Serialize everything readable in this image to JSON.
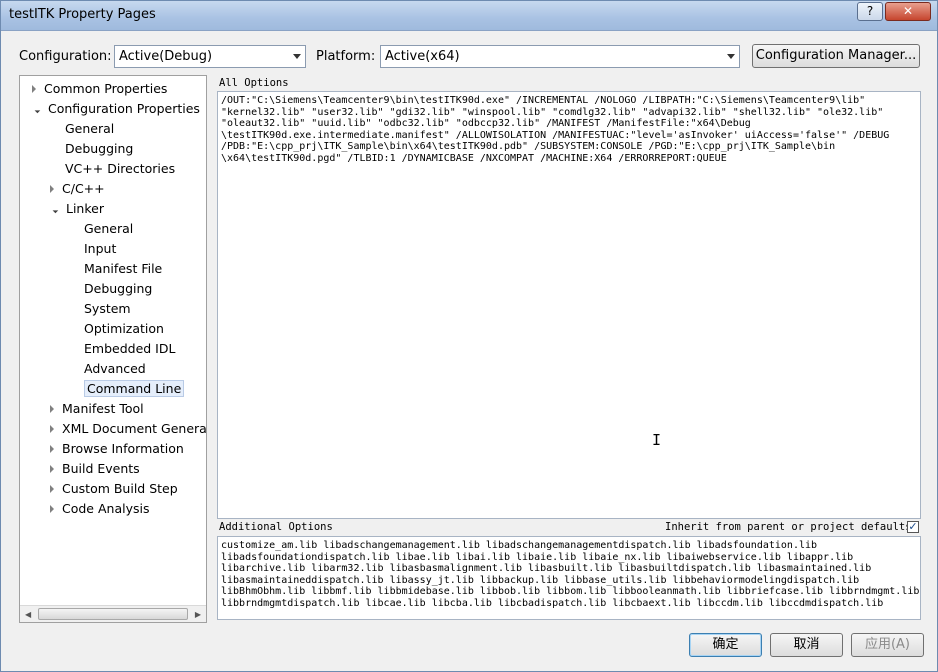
{
  "window": {
    "title": "testITK Property Pages",
    "help_glyph": "?",
    "close_glyph": "✕"
  },
  "config": {
    "configuration_label": "Configuration:",
    "configuration_value": "Active(Debug)",
    "platform_label": "Platform:",
    "platform_value": "Active(x64)",
    "manager_button": "Configuration Manager..."
  },
  "tree": {
    "items": [
      {
        "label": "Common Properties",
        "expander": "collapsed"
      },
      {
        "label": "Configuration Properties",
        "expander": "expanded"
      },
      {
        "label": "General",
        "expander": "none"
      },
      {
        "label": "Debugging",
        "expander": "none"
      },
      {
        "label": "VC++ Directories",
        "expander": "none"
      },
      {
        "label": "C/C++",
        "expander": "collapsed"
      },
      {
        "label": "Linker",
        "expander": "expanded"
      },
      {
        "label": "General",
        "expander": "none"
      },
      {
        "label": "Input",
        "expander": "none"
      },
      {
        "label": "Manifest File",
        "expander": "none"
      },
      {
        "label": "Debugging",
        "expander": "none"
      },
      {
        "label": "System",
        "expander": "none"
      },
      {
        "label": "Optimization",
        "expander": "none"
      },
      {
        "label": "Embedded IDL",
        "expander": "none"
      },
      {
        "label": "Advanced",
        "expander": "none"
      },
      {
        "label": "Command Line",
        "expander": "none",
        "selected": true
      },
      {
        "label": "Manifest Tool",
        "expander": "collapsed"
      },
      {
        "label": "XML Document Generat",
        "expander": "collapsed"
      },
      {
        "label": "Browse Information",
        "expander": "collapsed"
      },
      {
        "label": "Build Events",
        "expander": "collapsed"
      },
      {
        "label": "Custom Build Step",
        "expander": "collapsed"
      },
      {
        "label": "Code Analysis",
        "expander": "collapsed"
      }
    ]
  },
  "all_options": {
    "label": "All Options",
    "text": "/OUT:\"C:\\Siemens\\Teamcenter9\\bin\\testITK90d.exe\" /INCREMENTAL /NOLOGO /LIBPATH:\"C:\\Siemens\\Teamcenter9\\lib\"\n\"kernel32.lib\" \"user32.lib\" \"gdi32.lib\" \"winspool.lib\" \"comdlg32.lib\" \"advapi32.lib\" \"shell32.lib\" \"ole32.lib\"\n\"oleaut32.lib\" \"uuid.lib\" \"odbc32.lib\" \"odbccp32.lib\" /MANIFEST /ManifestFile:\"x64\\Debug\n\\testITK90d.exe.intermediate.manifest\" /ALLOWISOLATION /MANIFESTUAC:\"level='asInvoker' uiAccess='false'\" /DEBUG\n/PDB:\"E:\\cpp_prj\\ITK_Sample\\bin\\x64\\testITK90d.pdb\" /SUBSYSTEM:CONSOLE /PGD:\"E:\\cpp_prj\\ITK_Sample\\bin\n\\x64\\testITK90d.pgd\" /TLBID:1 /DYNAMICBASE /NXCOMPAT /MACHINE:X64 /ERRORREPORT:QUEUE"
  },
  "additional_options": {
    "label": "Additional Options",
    "inherit_label": "Inherit from parent or project defaults",
    "inherit_checked": "✓",
    "text": "customize_am.lib libadschangemanagement.lib libadschangemanagementdispatch.lib libadsfoundation.lib\nlibadsfoundationdispatch.lib libae.lib libai.lib libaie.lib libaie_nx.lib libaiwebservice.lib libappr.lib\nlibarchive.lib libarm32.lib libasbasmalignment.lib libasbuilt.lib libasbuiltdispatch.lib libasmaintained.lib\nlibasmaintaineddispatch.lib libassy_jt.lib libbackup.lib libbase_utils.lib libbehaviormodelingdispatch.lib\nlibBhmObhm.lib libbmf.lib libbmidebase.lib libbob.lib libbom.lib libbooleanmath.lib libbriefcase.lib libbrndmgmt.lib\nlibbrndmgmtdispatch.lib libcae.lib libcba.lib libcbadispatch.lib libcbaext.lib libccdm.lib libccdmdispatch.lib"
  },
  "buttons": {
    "ok": "确定",
    "cancel": "取消",
    "apply": "应用(A)"
  },
  "cursor_glyph": "I"
}
